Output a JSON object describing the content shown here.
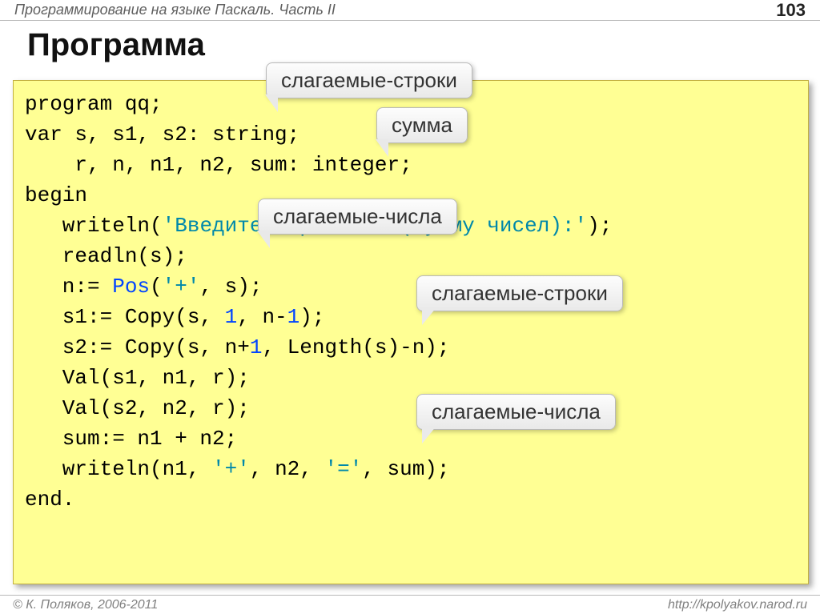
{
  "header": {
    "subtitle": "Программирование на языке Паскаль. Часть II",
    "page_number": "103"
  },
  "title": "Программа",
  "code": {
    "l01_a": "program qq;",
    "l02_a": "var s, s1, s2: string;",
    "l03_a": "    r, n, n1, n2, sum: integer;",
    "l04_a": "begin",
    "l05_a": "   writeln(",
    "l05_str": "'Введите выражение (сумму чисел):'",
    "l05_c": ");",
    "l06_a": "   readln(s);",
    "l07_a": "   n:= ",
    "l07_b": "Pos",
    "l07_c": "(",
    "l07_str": "'+'",
    "l07_d": ", s);",
    "l08_a": "   s1:= Copy(s, ",
    "l08_n1": "1",
    "l08_b": ", n-",
    "l08_n2": "1",
    "l08_c": ");",
    "l09_a": "   s2:= Copy(s, n+",
    "l09_n1": "1",
    "l09_b": ", Length(s)-n);",
    "l10_a": "   Val(s1, n1, r);",
    "l11_a": "   Val(s2, n2, r);",
    "l12_a": "   sum:= n1 + n2;",
    "l13_a": "   writeln(n1, ",
    "l13_s1": "'+'",
    "l13_b": ", n2, ",
    "l13_s2": "'='",
    "l13_c": ", sum);",
    "l14_a": "end."
  },
  "callouts": {
    "c1": "слагаемые-строки",
    "c2": "сумма",
    "c3": "слагаемые-числа",
    "c4": "слагаемые-строки",
    "c5": "слагаемые-числа"
  },
  "footer": {
    "copyright": "© К. Поляков, 2006-2011",
    "url": "http://kpolyakov.narod.ru"
  }
}
